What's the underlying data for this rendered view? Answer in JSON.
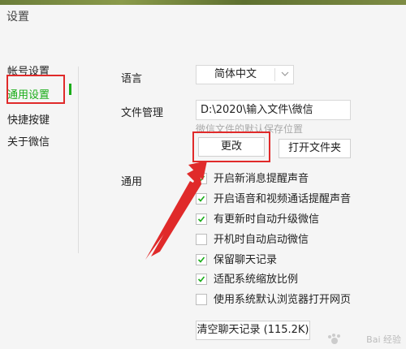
{
  "window": {
    "title": "设置"
  },
  "sidebar": {
    "items": [
      {
        "label": "帐号设置"
      },
      {
        "label": "通用设置",
        "active": true
      },
      {
        "label": "快捷按键"
      },
      {
        "label": "关于微信"
      }
    ]
  },
  "language": {
    "label": "语言",
    "value": "简体中文"
  },
  "file_management": {
    "label": "文件管理",
    "path": "D:\\2020\\输入文件\\微信",
    "hint": "微信文件的默认保存位置",
    "change_label": "更改",
    "open_folder_label": "打开文件夹"
  },
  "general": {
    "label": "通用",
    "options": [
      {
        "label": "开启新消息提醒声音",
        "checked": true
      },
      {
        "label": "开启语音和视频通话提醒声音",
        "checked": true
      },
      {
        "label": "有更新时自动升级微信",
        "checked": true
      },
      {
        "label": "开机时自动启动微信",
        "checked": false
      },
      {
        "label": "保留聊天记录",
        "checked": true
      },
      {
        "label": "适配系统缩放比例",
        "checked": true
      },
      {
        "label": "使用系统默认浏览器打开网页",
        "checked": false
      }
    ],
    "clear_label": "清空聊天记录 (115.2K)"
  },
  "watermark": {
    "text": "Bai 经验"
  },
  "colors": {
    "accent": "#1aad19",
    "annotation": "#e02a2a"
  }
}
